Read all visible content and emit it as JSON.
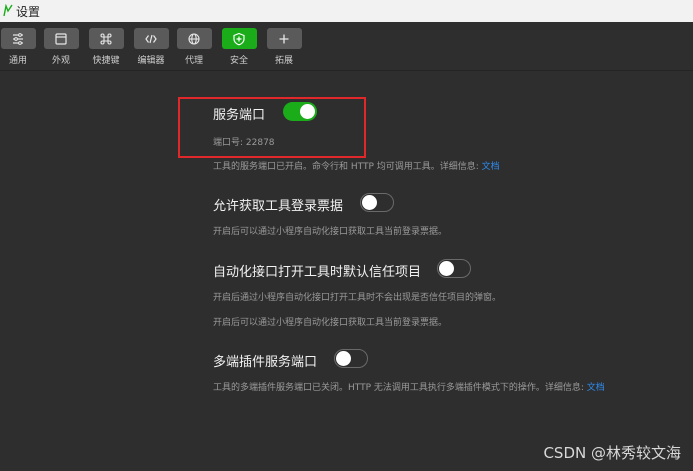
{
  "window": {
    "title": "设置"
  },
  "toolbar": {
    "items": [
      {
        "label": "通用",
        "icon": "sliders-icon"
      },
      {
        "label": "外观",
        "icon": "window-icon"
      },
      {
        "label": "快捷键",
        "icon": "command-key-icon"
      },
      {
        "label": "编辑器",
        "icon": "code-icon"
      },
      {
        "label": "代理",
        "icon": "globe-icon"
      },
      {
        "label": "安全",
        "icon": "shield-icon",
        "active": true
      },
      {
        "label": "拓展",
        "icon": "plus-icon"
      }
    ]
  },
  "service_port": {
    "title": "服务端口",
    "enabled": true,
    "port_label": "端口号: 22878",
    "desc": "工具的服务端口已开启。命令行和 HTTP 均可调用工具。详细信息: ",
    "link": "文档"
  },
  "login_ticket": {
    "title": "允许获取工具登录票据",
    "enabled": false,
    "desc": "开启后可以通过小程序自动化接口获取工具当前登录票据。"
  },
  "auto_trust": {
    "title": "自动化接口打开工具时默认信任项目",
    "enabled": false,
    "desc1": "开启后通过小程序自动化接口打开工具时不会出现是否信任项目的弹窗。",
    "desc2": "开启后可以通过小程序自动化接口获取工具当前登录票据。"
  },
  "multi_plugin": {
    "title": "多端插件服务端口",
    "enabled": false,
    "desc": "工具的多端插件服务端口已关闭。HTTP 无法调用工具执行多端插件模式下的操作。详细信息: ",
    "link": "文档"
  },
  "watermark": "CSDN @林秀较文海",
  "colors": {
    "accent": "#1aad19",
    "link": "#2d8cf0",
    "highlight": "#e0282a",
    "background": "#2e2e2e"
  }
}
